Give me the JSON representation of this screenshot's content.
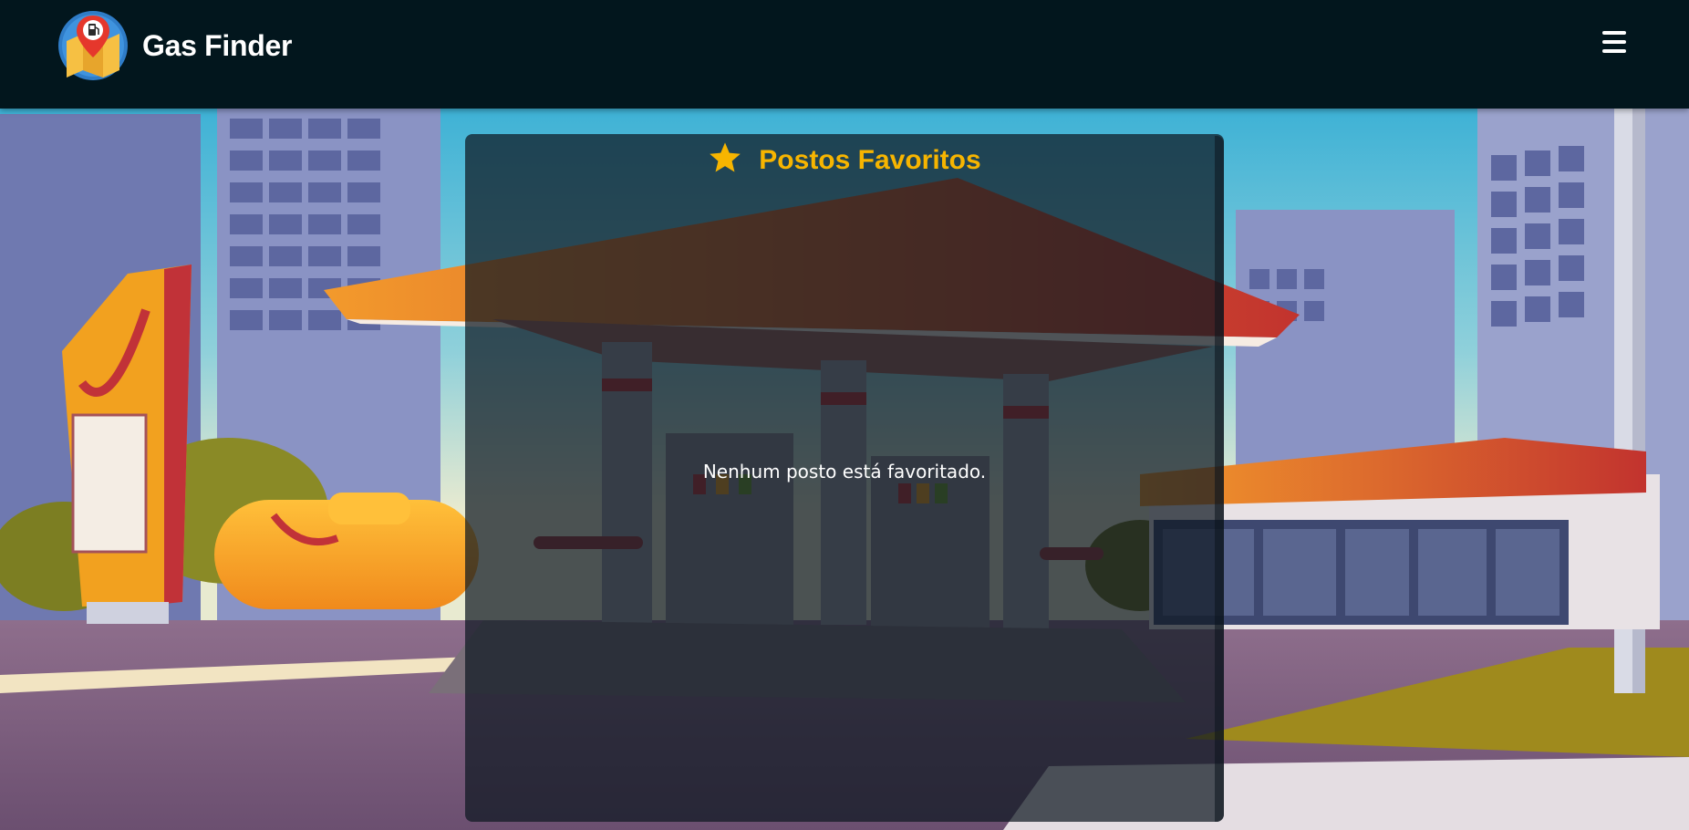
{
  "header": {
    "app_name": "Gas Finder",
    "logo_icon": "map-pin-fuel-logo",
    "menu_icon": "hamburger-menu-icon"
  },
  "favorites": {
    "title": "Postos Favoritos",
    "title_icon": "star-icon",
    "empty_message": "Nenhum posto está favoritado."
  },
  "colors": {
    "header_bg": "#02161d",
    "accent": "#f7b500",
    "text": "#ffffff"
  }
}
